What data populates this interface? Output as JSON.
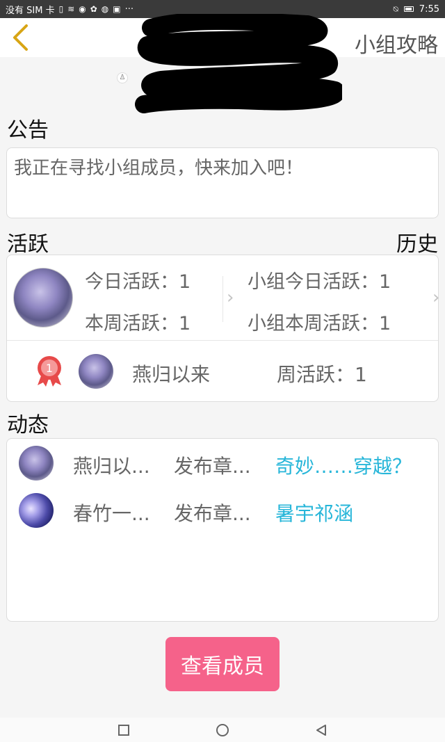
{
  "status_bar": {
    "carrier": "没有 SIM 卡",
    "time": "7:55",
    "more": "···"
  },
  "header": {
    "title": "小组攻略"
  },
  "notice": {
    "title": "公告",
    "text": "我正在寻找小组成员，快来加入吧！"
  },
  "activity": {
    "title": "活跃",
    "history_label": "历史",
    "today_active": "今日活跃：1",
    "week_active": "本周活跃：1",
    "group_today_active": "小组今日活跃：1",
    "group_week_active": "小组本周活跃：1",
    "rank": {
      "number": "1",
      "name": "燕归以来",
      "week_active": "周活跃：1"
    }
  },
  "feed": {
    "title": "动态",
    "items": [
      {
        "name": "燕归以...",
        "action": "发布章...",
        "link": "奇妙……穿越？"
      },
      {
        "name": "春竹一...",
        "action": "发布章...",
        "link": "暑宇祁涵"
      }
    ]
  },
  "buttons": {
    "view_members": "查看成员"
  },
  "colors": {
    "accent_pink": "#f5628a",
    "link_blue": "#27b6d9",
    "back_arrow": "#d8a515"
  }
}
